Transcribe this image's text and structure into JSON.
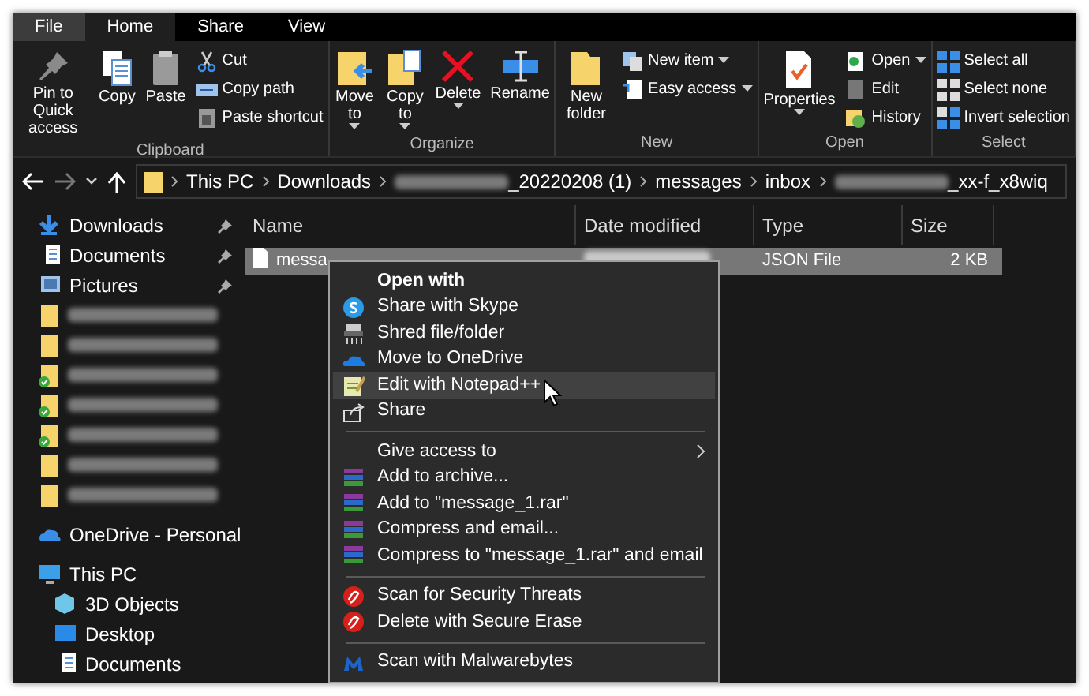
{
  "tabs": [
    {
      "label": "File",
      "kind": "file",
      "selected": false
    },
    {
      "label": "Home",
      "kind": "tab",
      "selected": true
    },
    {
      "label": "Share",
      "kind": "tab",
      "selected": false
    },
    {
      "label": "View",
      "kind": "tab",
      "selected": false
    }
  ],
  "ribbon": [
    {
      "label": "Clipboard",
      "large": [
        {
          "label": "Pin to Quick access",
          "menu": false
        },
        {
          "label": "Copy",
          "menu": false
        },
        {
          "label": "Paste",
          "menu": false
        }
      ],
      "small": [
        {
          "label": "Cut",
          "menu": false
        },
        {
          "label": "Copy path",
          "menu": false
        },
        {
          "label": "Paste shortcut",
          "menu": false
        }
      ]
    },
    {
      "label": "Organize",
      "large": [
        {
          "label": "Move to",
          "menu": true
        },
        {
          "label": "Copy to",
          "menu": true
        },
        {
          "label": "Delete",
          "menu": true
        },
        {
          "label": "Rename",
          "menu": false
        }
      ]
    },
    {
      "label": "New",
      "large": [
        {
          "label": "New folder",
          "menu": false
        }
      ],
      "small": [
        {
          "label": "New item",
          "menu": true
        },
        {
          "label": "Easy access",
          "menu": true
        }
      ]
    },
    {
      "label": "Open",
      "large": [
        {
          "label": "Properties",
          "menu": true
        }
      ],
      "small": [
        {
          "label": "Open",
          "menu": true
        },
        {
          "label": "Edit",
          "menu": false
        },
        {
          "label": "History",
          "menu": false
        }
      ]
    },
    {
      "label": "Select",
      "small": [
        {
          "label": "Select all",
          "menu": false
        },
        {
          "label": "Select none",
          "menu": false
        },
        {
          "label": "Invert selection",
          "menu": false
        }
      ]
    }
  ],
  "address": [
    {
      "label": "This PC",
      "redacted": false
    },
    {
      "label": "Downloads",
      "redacted": false
    },
    {
      "label": "_20220208 (1)",
      "redacted": true
    },
    {
      "label": "messages",
      "redacted": false
    },
    {
      "label": "inbox",
      "redacted": false
    },
    {
      "label": "_xx-f_x8wiq",
      "redacted": true
    }
  ],
  "sidebar": [
    {
      "kind": "item",
      "label": "Downloads",
      "pinned": true
    },
    {
      "kind": "item",
      "label": "Documents",
      "pinned": true
    },
    {
      "kind": "item",
      "label": "Pictures",
      "pinned": true
    },
    {
      "kind": "redacted",
      "synced": false
    },
    {
      "kind": "redacted",
      "synced": false
    },
    {
      "kind": "redacted",
      "synced": true
    },
    {
      "kind": "redacted",
      "synced": true
    },
    {
      "kind": "redacted",
      "synced": true
    },
    {
      "kind": "redacted",
      "synced": false
    },
    {
      "kind": "redacted",
      "synced": false
    },
    {
      "kind": "gap"
    },
    {
      "kind": "item",
      "label": "OneDrive - Personal",
      "pinned": false
    },
    {
      "kind": "gap"
    },
    {
      "kind": "item",
      "label": "This PC",
      "pinned": false
    },
    {
      "kind": "item",
      "label": "3D Objects",
      "pinned": false
    },
    {
      "kind": "item",
      "label": "Desktop",
      "pinned": false
    },
    {
      "kind": "item",
      "label": "Documents",
      "pinned": false
    }
  ],
  "columns": [
    "Name",
    "Date modified",
    "Type",
    "Size"
  ],
  "rows": [
    {
      "name": "messa",
      "type": "JSON File",
      "size": "2 KB",
      "selected": true
    }
  ],
  "context_menu": [
    {
      "kind": "header",
      "label": "Open with",
      "selected": false
    },
    {
      "kind": "item",
      "label": "Share with Skype",
      "selected": false
    },
    {
      "kind": "item",
      "label": "Shred file/folder",
      "selected": false
    },
    {
      "kind": "item",
      "label": "Move to OneDrive",
      "selected": false
    },
    {
      "kind": "item",
      "label": "Edit with Notepad++",
      "selected": true
    },
    {
      "kind": "item",
      "label": "Share",
      "selected": false
    },
    {
      "kind": "separator"
    },
    {
      "kind": "submenu",
      "label": "Give access to",
      "selected": false
    },
    {
      "kind": "item",
      "label": "Add to archive...",
      "selected": false
    },
    {
      "kind": "item",
      "label": "Add to \"message_1.rar\"",
      "selected": false
    },
    {
      "kind": "item",
      "label": "Compress and email...",
      "selected": false
    },
    {
      "kind": "item",
      "label": "Compress to \"message_1.rar\" and email",
      "selected": false
    },
    {
      "kind": "separator"
    },
    {
      "kind": "item",
      "label": "Scan for Security Threats",
      "selected": false
    },
    {
      "kind": "item",
      "label": "Delete with Secure Erase",
      "selected": false
    },
    {
      "kind": "separator"
    },
    {
      "kind": "item",
      "label": "Scan with Malwarebytes",
      "selected": false
    }
  ]
}
